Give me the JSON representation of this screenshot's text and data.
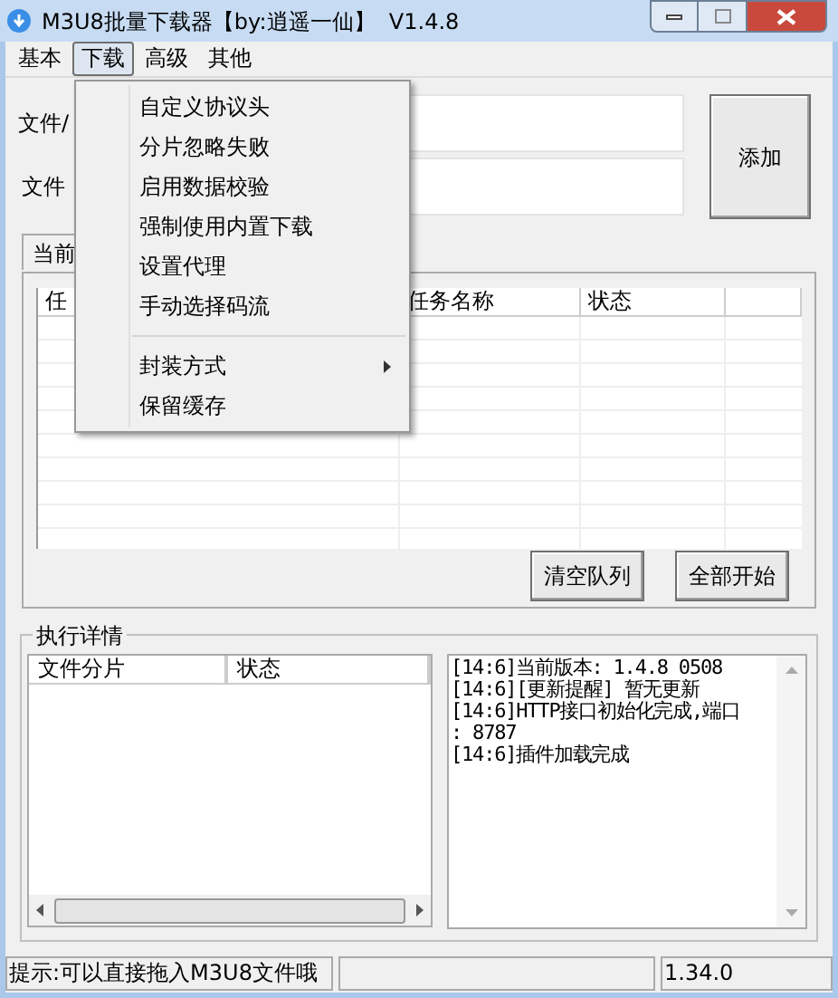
{
  "window": {
    "title": "M3U8批量下载器【by:逍遥一仙】  V1.4.8"
  },
  "menu_bar": [
    {
      "label": "基本",
      "selected": false
    },
    {
      "label": "下载",
      "selected": true
    },
    {
      "label": "高级",
      "selected": false
    },
    {
      "label": "其他",
      "selected": false
    }
  ],
  "dropdown": [
    {
      "kind": "item",
      "label": "自定义协议头"
    },
    {
      "kind": "item",
      "label": "分片忽略失败"
    },
    {
      "kind": "item",
      "label": "启用数据校验"
    },
    {
      "kind": "item",
      "label": "强制使用内置下载"
    },
    {
      "kind": "item",
      "label": "设置代理"
    },
    {
      "kind": "item",
      "label": "手动选择码流"
    },
    {
      "kind": "separator"
    },
    {
      "kind": "submenu",
      "label": "封装方式"
    },
    {
      "kind": "item",
      "label": "保留缓存"
    }
  ],
  "form": {
    "file_label": "文件/",
    "name_label": "文件",
    "add_button": "添加"
  },
  "queue": {
    "tab": "当前",
    "columns": [
      "任",
      "任务名称",
      "状态"
    ],
    "buttons": [
      "清空队列",
      "全部开始"
    ]
  },
  "details": {
    "title": "执行详情",
    "columns": [
      "文件分片",
      "状态"
    ],
    "log": [
      "[14:6]当前版本: 1.4.8 0508",
      "[14:6][更新提醒] 暂无更新",
      "[14:6]HTTP接口初始化完成,端口",
      ": 8787",
      "[14:6]插件加载完成"
    ]
  },
  "status_bar": [
    "提示:可以直接拖入M3U8文件哦",
    "1.34.0"
  ]
}
